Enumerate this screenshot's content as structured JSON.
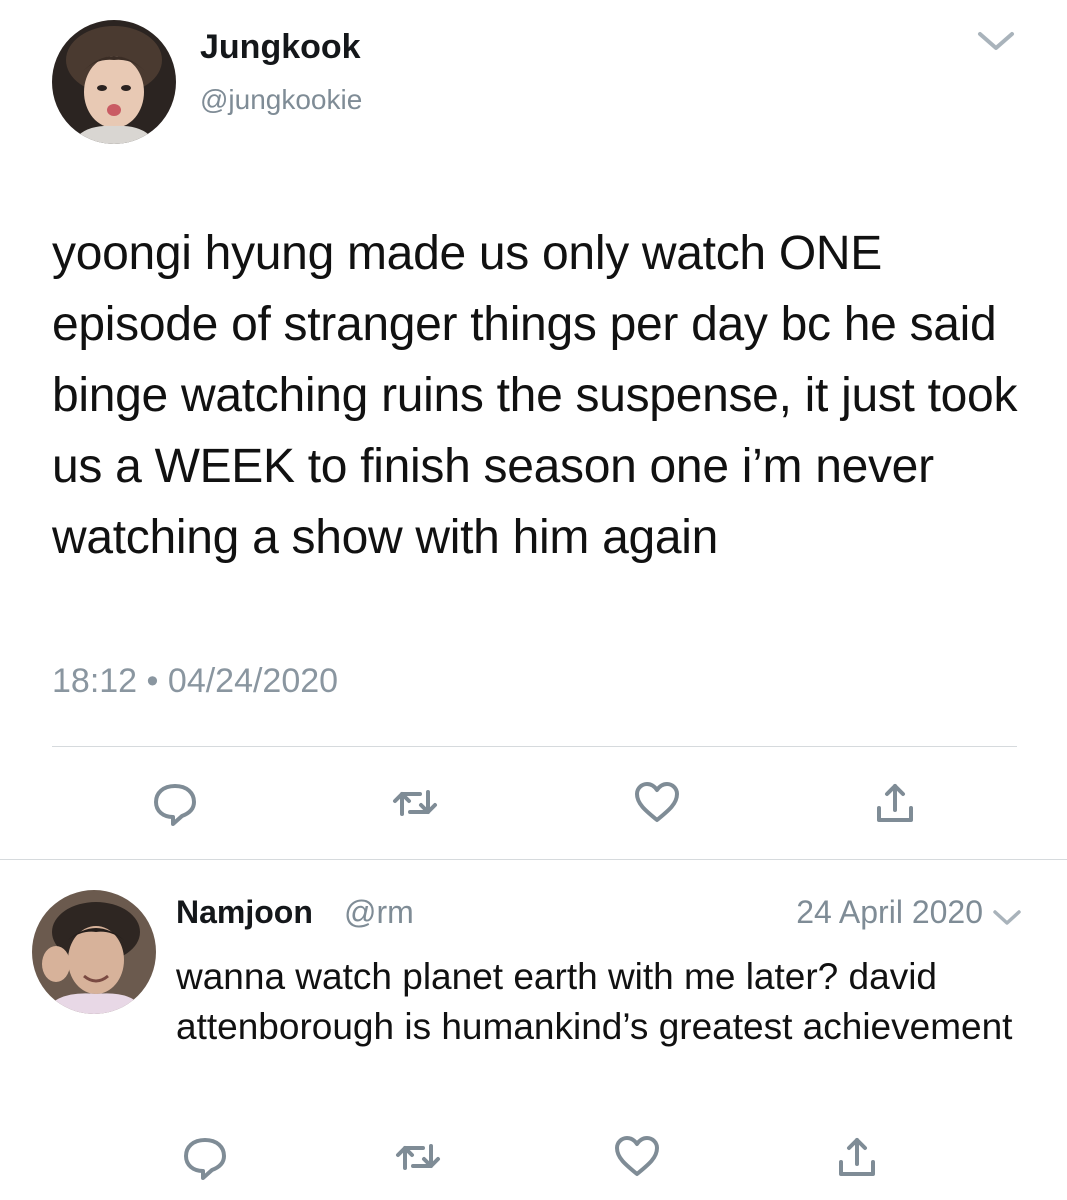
{
  "main_tweet": {
    "display_name": "Jungkook",
    "handle": "@jungkookie",
    "text": "yoongi hyung made us only watch ONE episode of stranger things per day bc he said binge watching ruins the suspense, it just took us a WEEK to finish season one i’m never watching a show with him again",
    "time": "18:12",
    "date": "04/24/2020",
    "icons": [
      "reply-icon",
      "retweet-icon",
      "like-icon",
      "share-icon",
      "chevron-down-icon"
    ]
  },
  "reply": {
    "display_name": "Namjoon",
    "handle": "@rm",
    "date": "24 April 2020",
    "text": "wanna watch planet earth with me later? david attenborough is humankind’s greatest achievement",
    "icons": [
      "reply-icon",
      "retweet-icon",
      "like-icon",
      "share-icon",
      "chevron-down-icon"
    ]
  },
  "colors": {
    "text": "#111111",
    "muted": "#7f8c96",
    "icon": "#7f8c96",
    "divider": "#d6dadd"
  }
}
